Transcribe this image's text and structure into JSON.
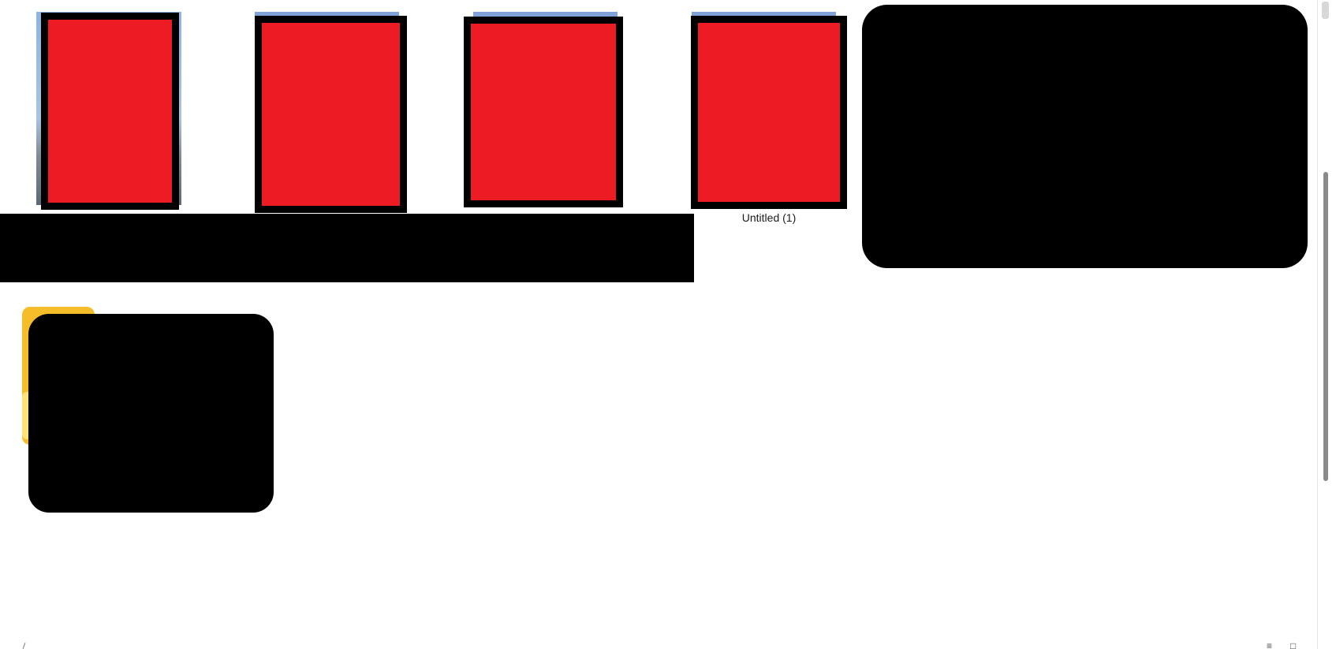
{
  "files": [
    {
      "name": "",
      "kind": "image"
    },
    {
      "name": "",
      "kind": "image"
    },
    {
      "name": "",
      "kind": "image"
    },
    {
      "name": "Untitled (1)",
      "kind": "image"
    }
  ],
  "folder": {
    "name": ""
  },
  "status_bar": {
    "details_view_icon": "≡",
    "large_icons_view_icon": "□"
  },
  "colors": {
    "thumbnail_fill": "#ed1c24",
    "thumbnail_border": "#000000",
    "redaction": "#000000",
    "folder": "#f6bd2a",
    "background": "#ffffff"
  },
  "icons": [
    "image-thumbnail-icon",
    "folder-icon",
    "details-view-icon",
    "large-icons-view-icon"
  ]
}
